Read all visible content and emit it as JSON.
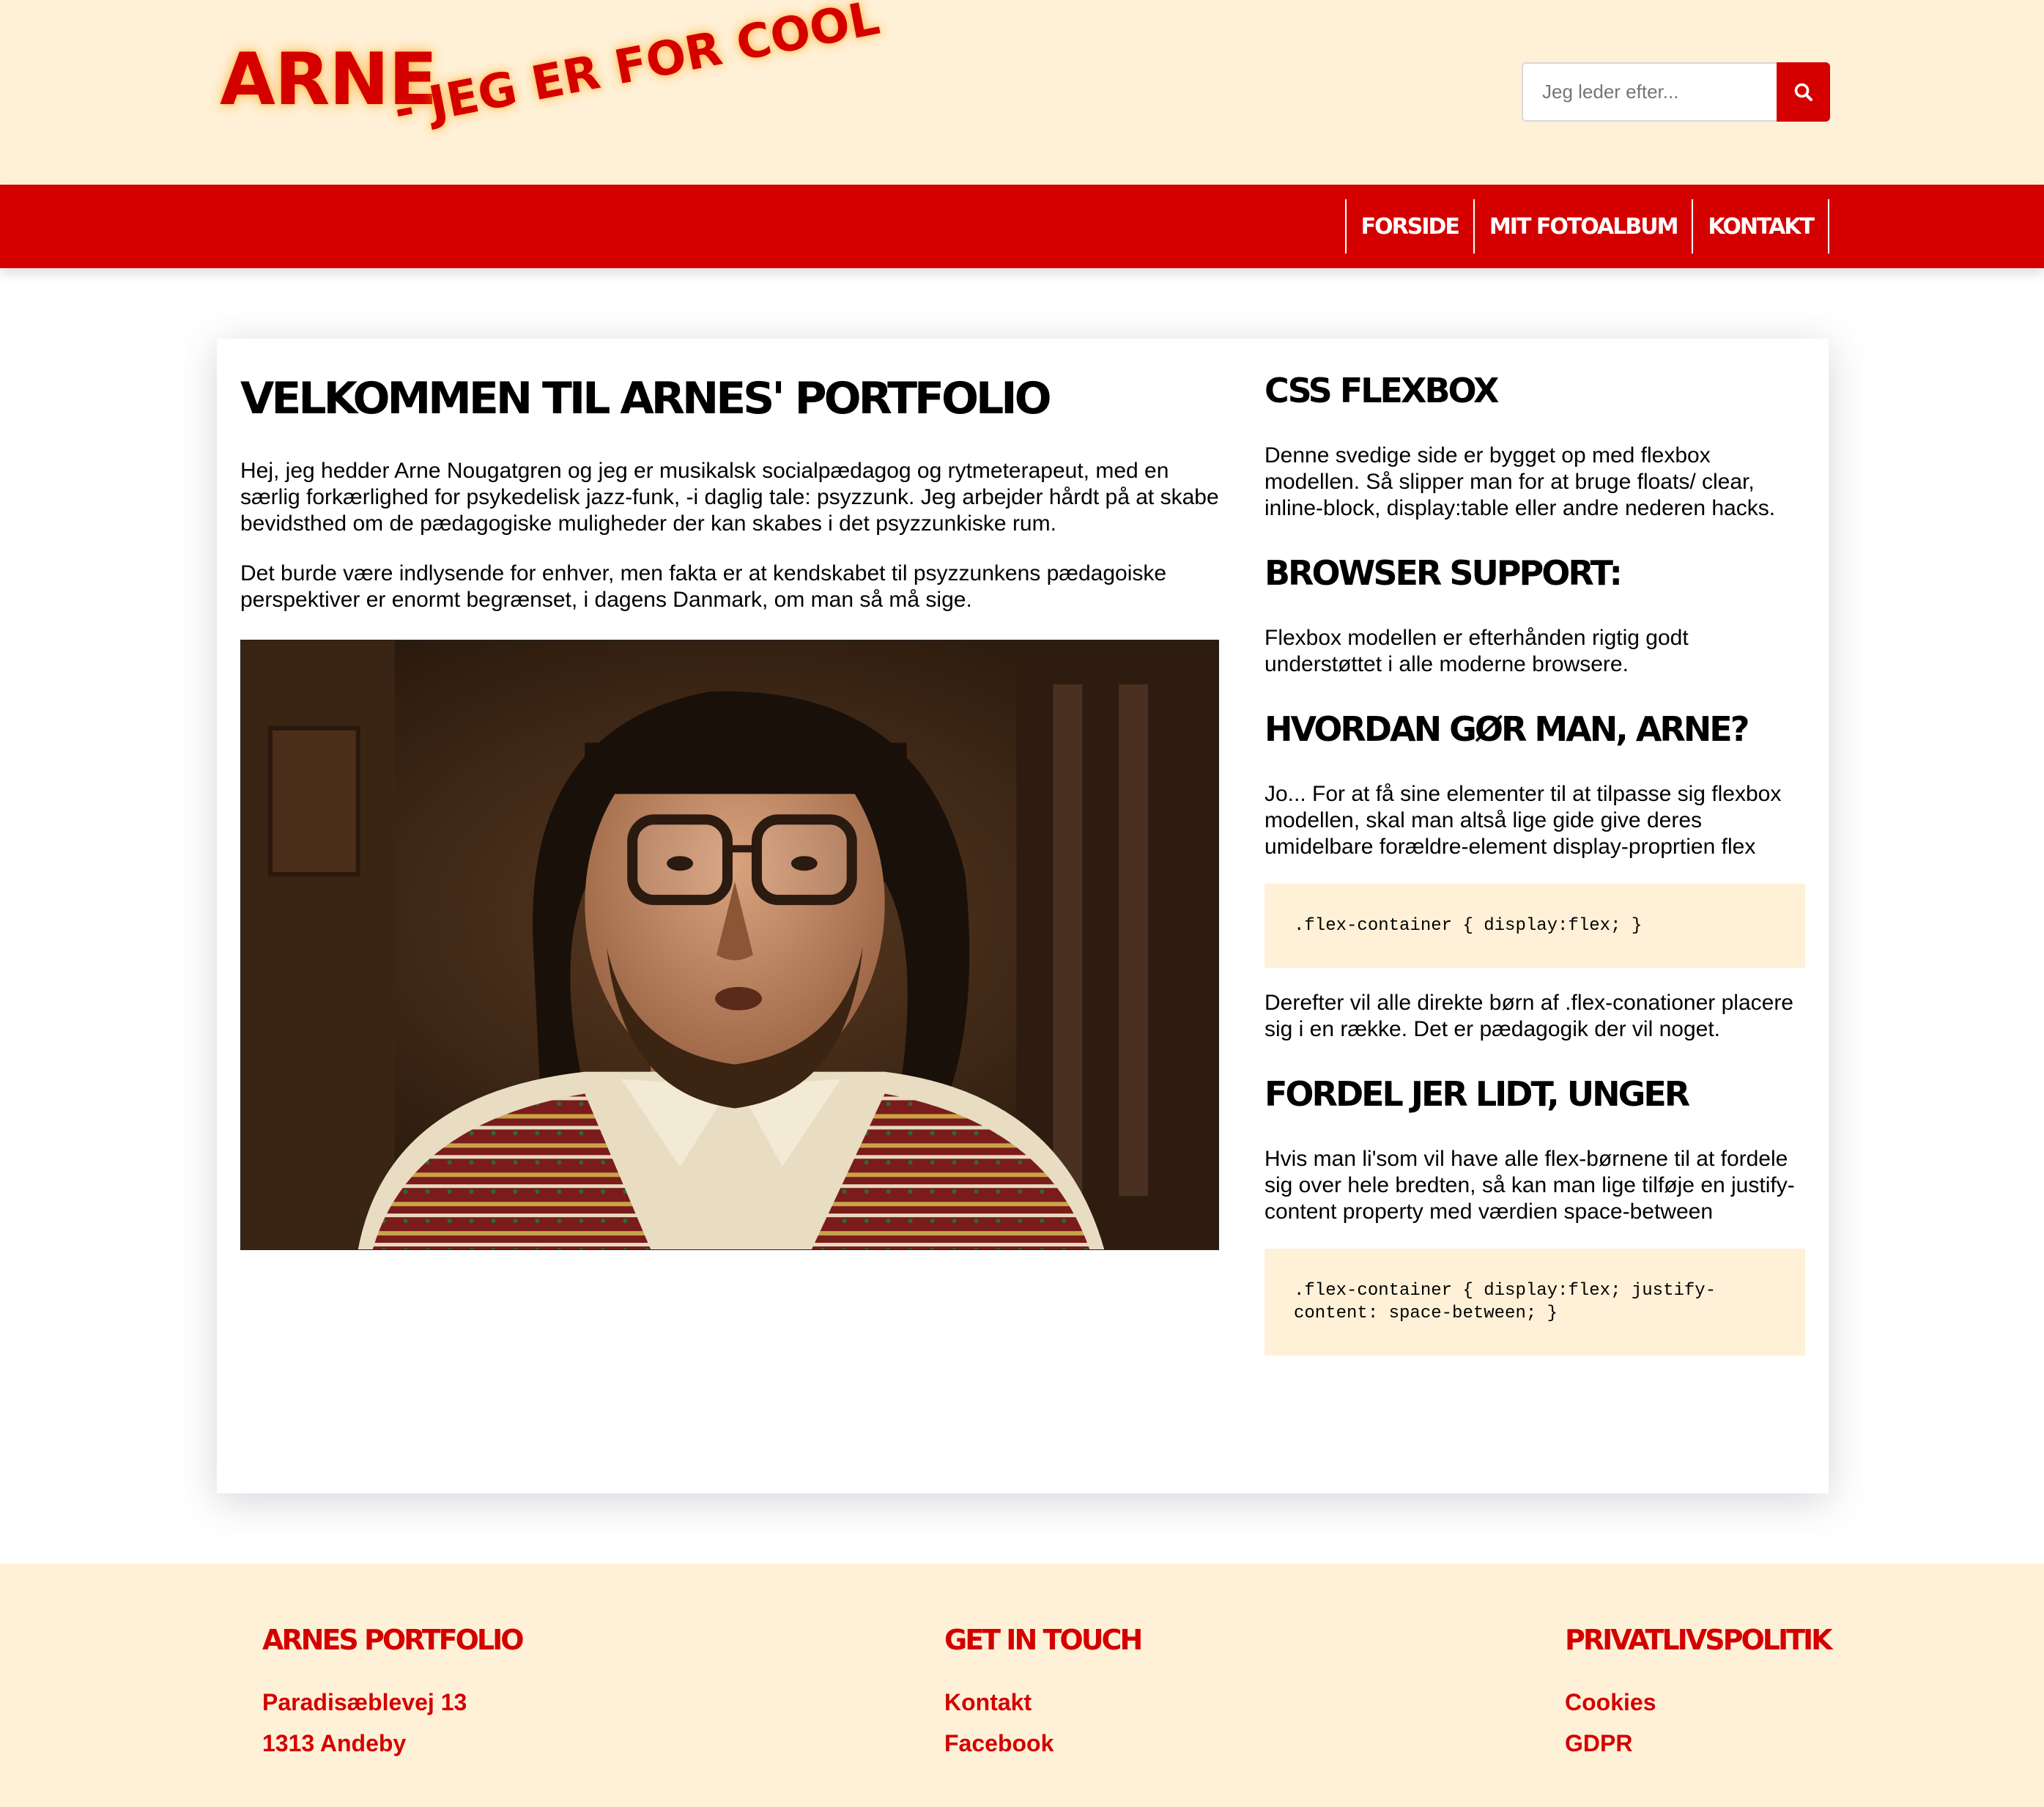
{
  "brand": {
    "name": "ARNE",
    "tagline": "- JEG ER FOR COOL",
    "accent_color": "#d40000",
    "cream_color": "#fff1d7"
  },
  "search": {
    "placeholder": "Jeg leder efter...",
    "button_icon": "search-icon"
  },
  "nav": {
    "items": [
      {
        "label": "FORSIDE"
      },
      {
        "label": "MIT FOTOALBUM"
      },
      {
        "label": "KONTAKT"
      }
    ]
  },
  "main": {
    "title": "VELKOMMEN TIL ARNES' PORTFOLIO",
    "paragraphs": [
      "Hej, jeg hedder Arne Nougatgren og jeg er musikalsk socialpædagog og rytmeterapeut, med en særlig forkærlighed for psykedelisk jazz-funk, -i daglig tale: psyzzunk. Jeg arbejder hårdt på at skabe bevidsthed om de pædagogiske muligheder der kan skabes i det psyzzunkiske rum.",
      "Det burde være indlysende for enhver, men fakta er at kendskabet til psyzzunkens pædagoiske perspektiver er enormt begrænset, i dagens Danmark, om man så må sige."
    ]
  },
  "aside": {
    "sections": [
      {
        "heading": "CSS FLEXBOX",
        "text": "Denne svedige side er bygget op med flexbox modellen. Så slipper man for at bruge floats/ clear, inline-block, display:table eller andre nederen hacks."
      },
      {
        "heading": "BROWSER SUPPORT:",
        "text": "Flexbox modellen er efterhånden rigtig godt understøttet i alle moderne browsere."
      },
      {
        "heading": "HVORDAN GØR MAN, ARNE?",
        "text": "Jo... For at få sine elementer til at tilpasse sig flexbox modellen, skal man altså lige gide give deres umidelbare forældre-element display-proprtien flex",
        "code": ".flex-container { display:flex; }",
        "after": "Derefter vil alle direkte børn af .flex-conationer placere sig i en række. Det er pædagogik der vil noget."
      },
      {
        "heading": "FORDEL JER LIDT, UNGER",
        "text": "Hvis man li'som vil have alle flex-børnene til at fordele sig over hele bredten, så kan man lige tilføje en justify-content property med værdien space-between",
        "code": ".flex-container { display:flex; justify-content: space-between; }"
      }
    ]
  },
  "footer": {
    "columns": [
      {
        "heading": "ARNES PORTFOLIO",
        "links": [
          "Paradisæblevej 13",
          "1313 Andeby"
        ]
      },
      {
        "heading": "GET IN TOUCH",
        "links": [
          "Kontakt",
          "Facebook"
        ]
      },
      {
        "heading": "PRIVATLIVSPOLITIK",
        "links": [
          "Cookies",
          "GDPR"
        ]
      }
    ]
  }
}
